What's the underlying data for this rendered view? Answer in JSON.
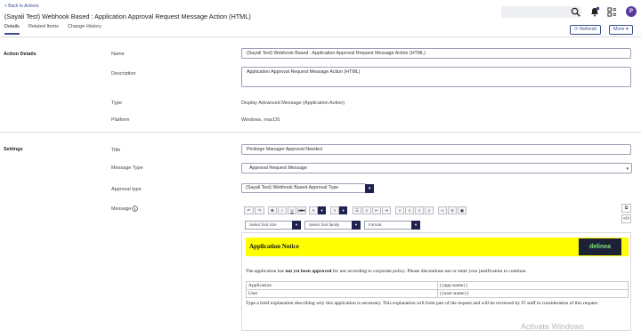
{
  "header": {
    "back_link": "< Back to Actions",
    "title": "(Sayali Test) Webhook Based : Application Approval Request Message Action (HTML)",
    "avatar_initial": "P"
  },
  "tabs": [
    "Details",
    "Related Items",
    "Change History"
  ],
  "buttons": {
    "refresh": "⟳ Refresh",
    "more": "More ▾"
  },
  "action_details": {
    "section_title": "Action Details",
    "name_label": "Name",
    "name_value": "(Sayali Test) Webhook Based : Application Approval Request Message Action (HTML)",
    "description_label": "Description",
    "description_value": "Application Approval Request Message Action (HTML)",
    "type_label": "Type",
    "type_value": "Display Advanced Message (Application Action)",
    "platform_label": "Platform",
    "platform_value": "Windows, macOS"
  },
  "settings": {
    "section_title": "Settings",
    "title_label": "Title",
    "title_value": "Privilege Manager Approval Needed",
    "message_type_label": "Message Type",
    "message_type_value": "Approval Request Message",
    "approval_type_label": "Approval type",
    "approval_type_value": "(Sayali Test) Webhook Based Approval Type",
    "message_label": "Message"
  },
  "toolbar": {
    "font_size": "Select font size",
    "font_family": "Select font family",
    "format": "Format"
  },
  "editor": {
    "banner_title": "Application Notice",
    "logo": "delinea",
    "notice_pre": "The application has ",
    "notice_bold": "not yet been approved",
    "notice_post": " for use according to corporate policy. Please discontinue use or enter your justification to continue.",
    "table_rows": [
      [
        "Application",
        "{{app-name}}"
      ],
      [
        "User",
        "{{user-name}}"
      ]
    ],
    "explanation": "Type a brief explanation describing why this application is necessary. This explanation will form part of the request and will be reviewed by IT staff in consideration of this request."
  },
  "watermark": "Activate Windows",
  "colors": {
    "accent": "#3a4d8f",
    "banner": "#ffff00",
    "logo_bg": "#1d2135",
    "dark_button": "#1f2250"
  }
}
